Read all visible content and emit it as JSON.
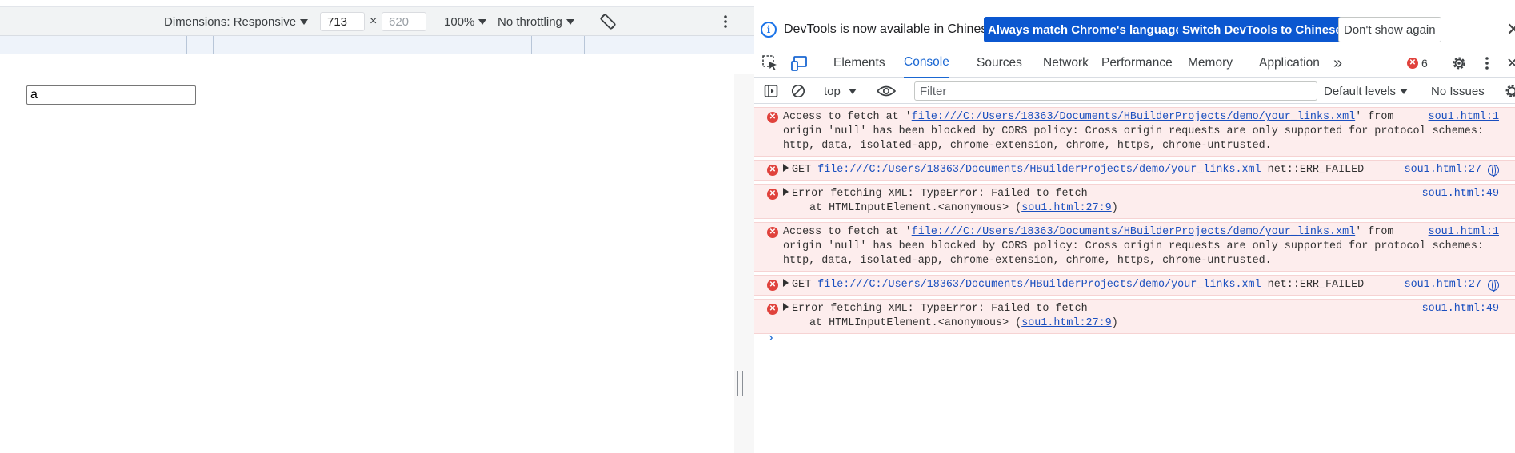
{
  "device_toolbar": {
    "dimensions_label": "Dimensions: Responsive",
    "width_value": "713",
    "times_sign": "×",
    "height_placeholder": "620",
    "zoom_label": "100%",
    "throttle_label": "No throttling"
  },
  "page": {
    "input_value": "a"
  },
  "infobar": {
    "message": "DevTools is now available in Chinese!",
    "btn_match": "Always match Chrome's language",
    "btn_switch": "Switch DevTools to Chinese",
    "btn_dismiss": "Don't show again",
    "close_glyph": "✕"
  },
  "tabs": {
    "elements": "Elements",
    "console": "Console",
    "sources": "Sources",
    "network": "Network",
    "performance": "Performance",
    "memory": "Memory",
    "application": "Application",
    "more_glyph": "»",
    "error_count": "6",
    "close_glyph": "✕"
  },
  "console_toolbar": {
    "context": "top",
    "filter_placeholder": "Filter",
    "levels": "Default levels",
    "issues": "No Issues"
  },
  "messages": [
    {
      "l1a": "Access to fetch at '",
      "url": "file:///C:/Users/18363/Documents/HBuilderProjects/demo/your_links.xml",
      "l1b": "' from",
      "l2": "origin 'null' has been blocked by CORS policy: Cross origin requests are only supported for protocol schemes:",
      "l3": "http, data, isolated-app, chrome-extension, chrome, https, chrome-untrusted.",
      "source": "sou1.html:1"
    },
    {
      "prefix": "GET",
      "url": "file:///C:/Users/18363/Documents/HBuilderProjects/demo/your_links.xml",
      "suffix": "net::ERR_FAILED",
      "source": "sou1.html:27"
    },
    {
      "l1": "Error fetching XML: TypeError: Failed to fetch",
      "l2a": "at HTMLInputElement.<anonymous> (",
      "l2link": "sou1.html:27:9",
      "l2b": ")",
      "source": "sou1.html:49"
    },
    {
      "l1a": "Access to fetch at '",
      "url": "file:///C:/Users/18363/Documents/HBuilderProjects/demo/your_links.xml",
      "l1b": "' from",
      "l2": "origin 'null' has been blocked by CORS policy: Cross origin requests are only supported for protocol schemes:",
      "l3": "http, data, isolated-app, chrome-extension, chrome, https, chrome-untrusted.",
      "source": "sou1.html:1"
    },
    {
      "prefix": "GET",
      "url": "file:///C:/Users/18363/Documents/HBuilderProjects/demo/your_links.xml",
      "suffix": "net::ERR_FAILED",
      "source": "sou1.html:27"
    },
    {
      "l1": "Error fetching XML: TypeError: Failed to fetch",
      "l2a": "at HTMLInputElement.<anonymous> (",
      "l2link": "sou1.html:27:9",
      "l2b": ")",
      "source": "sou1.html:49"
    }
  ],
  "prompt_glyph": "›",
  "colors": {
    "accent": "#1a67d2",
    "primary_button": "#0b57d0",
    "error_bg": "#fdeded",
    "error_icon": "#e0423c",
    "link": "#1a4fbf"
  }
}
